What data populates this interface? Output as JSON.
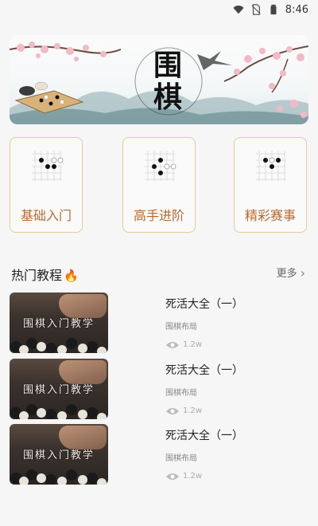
{
  "status": {
    "time": "8:46"
  },
  "banner": {
    "title_line1": "围",
    "title_line2": "棋"
  },
  "categories": [
    {
      "label": "基础入门"
    },
    {
      "label": "高手进阶"
    },
    {
      "label": "精彩赛事"
    }
  ],
  "section": {
    "title": "热门教程",
    "more": "更多"
  },
  "lessons": [
    {
      "title": "死活大全（一）",
      "subtitle": "围棋布局",
      "views": "1.2w",
      "thumb_text": "围棋入门教学"
    },
    {
      "title": "死活大全（一）",
      "subtitle": "围棋布局",
      "views": "1.2w",
      "thumb_text": "围棋入门教学"
    },
    {
      "title": "死活大全（一）",
      "subtitle": "围棋布局",
      "views": "1.2w",
      "thumb_text": "围棋入门教学"
    }
  ],
  "colors": {
    "accent": "#b9692d",
    "card_border": "#e6c99a",
    "fire": "#e8552c"
  },
  "icons": [
    "wifi-icon",
    "no-sim-icon",
    "battery-icon",
    "fire-icon",
    "chevron-right-icon",
    "eye-icon"
  ]
}
